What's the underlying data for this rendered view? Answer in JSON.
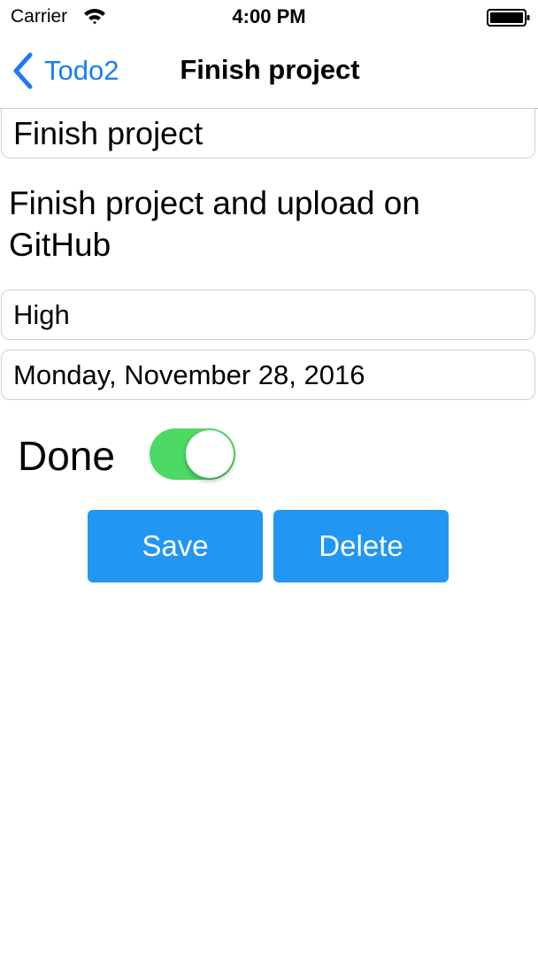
{
  "status_bar": {
    "carrier": "Carrier",
    "time": "4:00 PM"
  },
  "nav": {
    "back_label": "Todo2",
    "title": "Finish project"
  },
  "form": {
    "title_value": "Finish project",
    "description": "Finish project and upload on GitHub",
    "priority_value": "High",
    "date_value": "Monday, November 28, 2016",
    "done_label": "Done",
    "done_on": true
  },
  "buttons": {
    "save_label": "Save",
    "delete_label": "Delete"
  },
  "colors": {
    "accent": "#1a7cf5",
    "button": "#2196f3",
    "toggle_on": "#4cd964"
  }
}
